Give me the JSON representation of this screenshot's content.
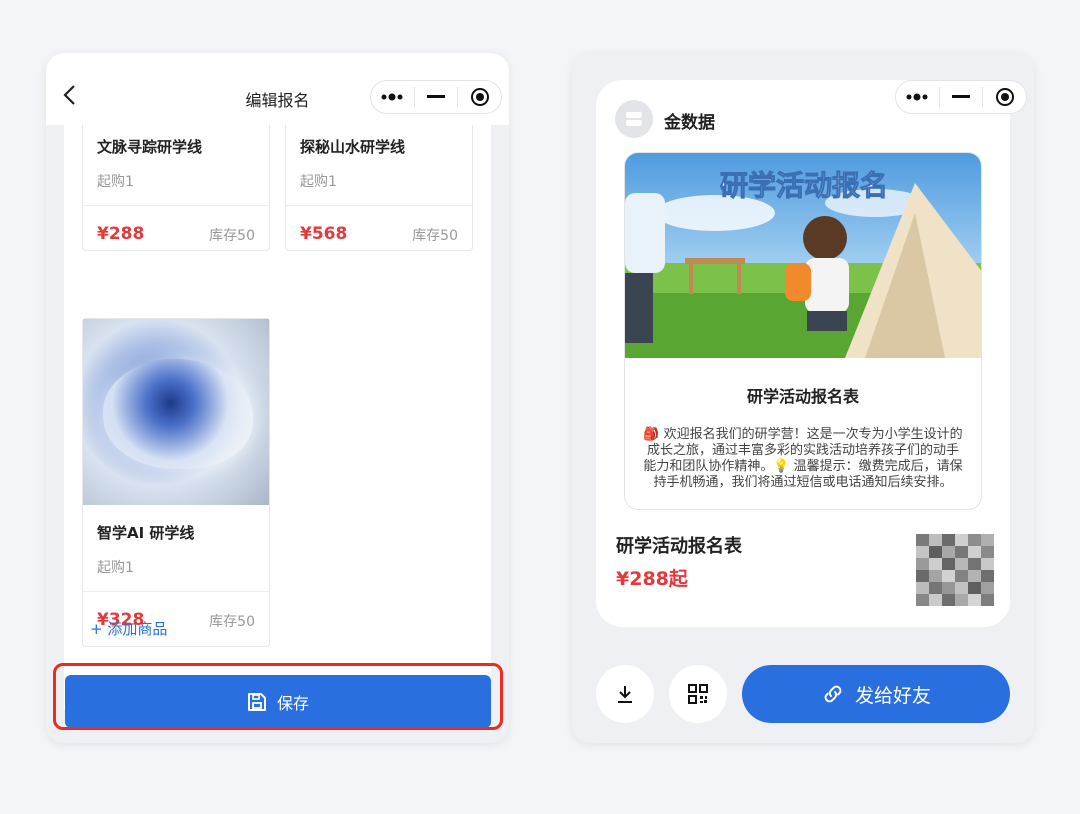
{
  "left": {
    "title": "编辑报名",
    "products": [
      {
        "name": "文脉寻踪研学线",
        "min": "起购1",
        "price": "¥288",
        "stock": "库存50"
      },
      {
        "name": "探秘山水研学线",
        "min": "起购1",
        "price": "¥568",
        "stock": "库存50"
      },
      {
        "name": "智学AI 研学线",
        "min": "起购1",
        "price": "¥328",
        "stock": "库存50"
      }
    ],
    "add_label": "+ 添加商品",
    "save_label": "保存"
  },
  "right": {
    "brand": "金数据",
    "poster_banner": "研学活动报名",
    "poster_heading": "研学活动报名表",
    "poster_desc": "🎒 欢迎报名我们的研学营！这是一次专为小学生设计的成长之旅，通过丰富多彩的实践活动培养孩子们的动手能力和团队协作精神。💡 温馨提示：缴费完成后，请保持手机畅通，我们将通过短信或电话通知后续安排。",
    "form_title": "研学活动报名表",
    "price": "¥288起",
    "send_label": "发给好友"
  },
  "icons": {
    "back": "chevron-left-icon",
    "more": "more-dots-icon",
    "minimize": "minus-icon",
    "close": "target-circle-icon",
    "save": "floppy-disk-icon",
    "download": "download-icon",
    "qrcode": "qr-code-icon",
    "link": "link-icon"
  },
  "colors": {
    "accent": "#2a6fe0",
    "price": "#e5383b",
    "highlight": "#ec2a1d"
  }
}
